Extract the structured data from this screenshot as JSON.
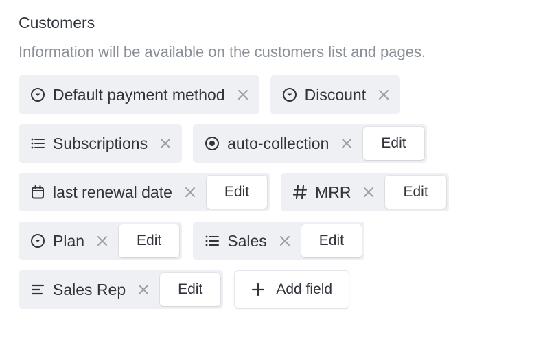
{
  "section": {
    "title": "Customers",
    "subtitle": "Information will be available on the customers list and pages."
  },
  "edit_label": "Edit",
  "add_field_label": "Add field",
  "fields": [
    {
      "label": "Default payment method",
      "icon": "dropdown-circle-icon",
      "editable": false
    },
    {
      "label": "Discount",
      "icon": "dropdown-circle-icon",
      "editable": false
    },
    {
      "label": "Subscriptions",
      "icon": "list-icon",
      "editable": false
    },
    {
      "label": "auto-collection",
      "icon": "radio-icon",
      "editable": true
    },
    {
      "label": "last renewal date",
      "icon": "calendar-icon",
      "editable": true
    },
    {
      "label": "MRR",
      "icon": "hash-icon",
      "editable": true
    },
    {
      "label": "Plan",
      "icon": "dropdown-circle-icon",
      "editable": true
    },
    {
      "label": "Sales",
      "icon": "list-icon",
      "editable": true
    },
    {
      "label": "Sales Rep",
      "icon": "text-icon",
      "editable": true
    }
  ],
  "colors": {
    "chip_bg": "#eef0f3",
    "text": "#30343b",
    "muted": "#8a8f98",
    "remove_x": "#9aa0a8"
  }
}
